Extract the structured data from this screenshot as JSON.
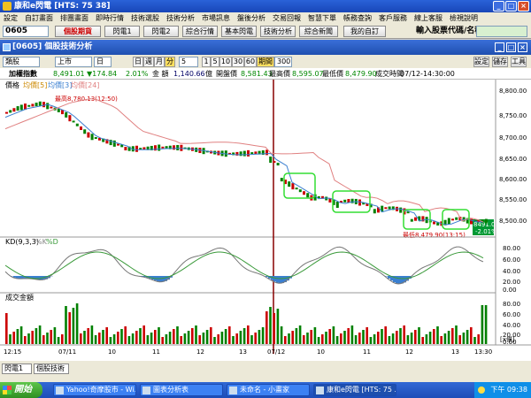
{
  "window": {
    "title": "康和e閃電 [HTS: 75 38]",
    "min": "_",
    "max": "□",
    "close": "×"
  },
  "menu": [
    "設定",
    "自訂畫面",
    "排團畫面",
    "即時行情",
    "技術選股",
    "技術分析",
    "市場訊息",
    "盤後分析",
    "交易回報",
    "智慧下單",
    "帳務查詢",
    "客戶服務",
    "線上客服",
    "檢視說明"
  ],
  "toolbar": {
    "code": "0605",
    "buttons": [
      "個股期貨",
      "閃電1",
      "閃電2",
      "綜合行情",
      "基本閃電",
      "技術分析",
      "綜合新聞",
      "我的自訂"
    ],
    "search_label": "輸入股票代碼/名稱:"
  },
  "subwindow": {
    "title": "[0605] 個股技術分析"
  },
  "controls": {
    "stock_type": "類股",
    "market": "上市",
    "period_box": "日",
    "period_buttons": [
      "日",
      "週",
      "月",
      "分"
    ],
    "minute": "5",
    "intervals": [
      "1",
      "5",
      "10",
      "30",
      "60"
    ],
    "period_label": "期間",
    "count": "300",
    "right_buttons": [
      "設定",
      "儲存",
      "工具"
    ]
  },
  "info": {
    "name": "加權指數",
    "price": "8,491.01",
    "change": "▼174.84",
    "pct": "2.01%",
    "amount_label": "金 額",
    "amount": "1,140.66",
    "vol_label": "億",
    "prev_label": "開盤價",
    "prev": "8,581.43",
    "high_label": "最高價",
    "high": "8,595.07",
    "low_label": "最低價",
    "low": "8,479.90",
    "time_label": "成交時間",
    "time": "07/12-14:30:00"
  },
  "price_panel": {
    "legend": [
      "價格",
      "均價[5]",
      "均價[3]",
      "均價[24]"
    ],
    "high_note": "最高8,780.13(12:50)",
    "low_note": "最低8,479.90(13:15)",
    "current_price": "8491.01",
    "current_pct": "-2.01%",
    "y_labels": [
      "8,800.00",
      "8,750.00",
      "8,700.00",
      "8,650.00",
      "8,600.00",
      "8,550.00",
      "8,500.00"
    ]
  },
  "kd_panel": {
    "legend": [
      "KD(9,3,3)",
      "%K",
      "%D"
    ],
    "y_labels": [
      "80.00",
      "60.00",
      "40.00",
      "20.00",
      "0.00"
    ]
  },
  "vol_panel": {
    "legend": "成交金額",
    "y_labels": [
      "80.00",
      "60.00",
      "40.00",
      "20.00",
      "0.00"
    ],
    "unit": "[x億]"
  },
  "x_labels": [
    {
      "t": "12:15"
    },
    {
      "t": "07/11"
    },
    {
      "t": "10"
    },
    {
      "t": "11"
    },
    {
      "t": "12"
    },
    {
      "t": "13"
    },
    {
      "t": "07/12"
    },
    {
      "t": "10"
    },
    {
      "t": "11"
    },
    {
      "t": "12"
    },
    {
      "t": "13"
    },
    {
      "t": "13:30"
    }
  ],
  "status": {
    "tab1": "閃電1",
    "tab2": "個股技術"
  },
  "taskbar": {
    "start": "開始",
    "tasks": [
      "Yahoo!奇摩股市 - Wi...",
      "圖表分析表",
      "未命名 - 小畫家",
      "康和e閃電 [HTS: 75 ..."
    ],
    "time": "下午 09:38"
  },
  "colors": {
    "up": "#cc0000",
    "down": "#008000",
    "ma_fast": "#3a7fd0",
    "ma_slow": "#e08080",
    "highlight": "#33dd33"
  }
}
